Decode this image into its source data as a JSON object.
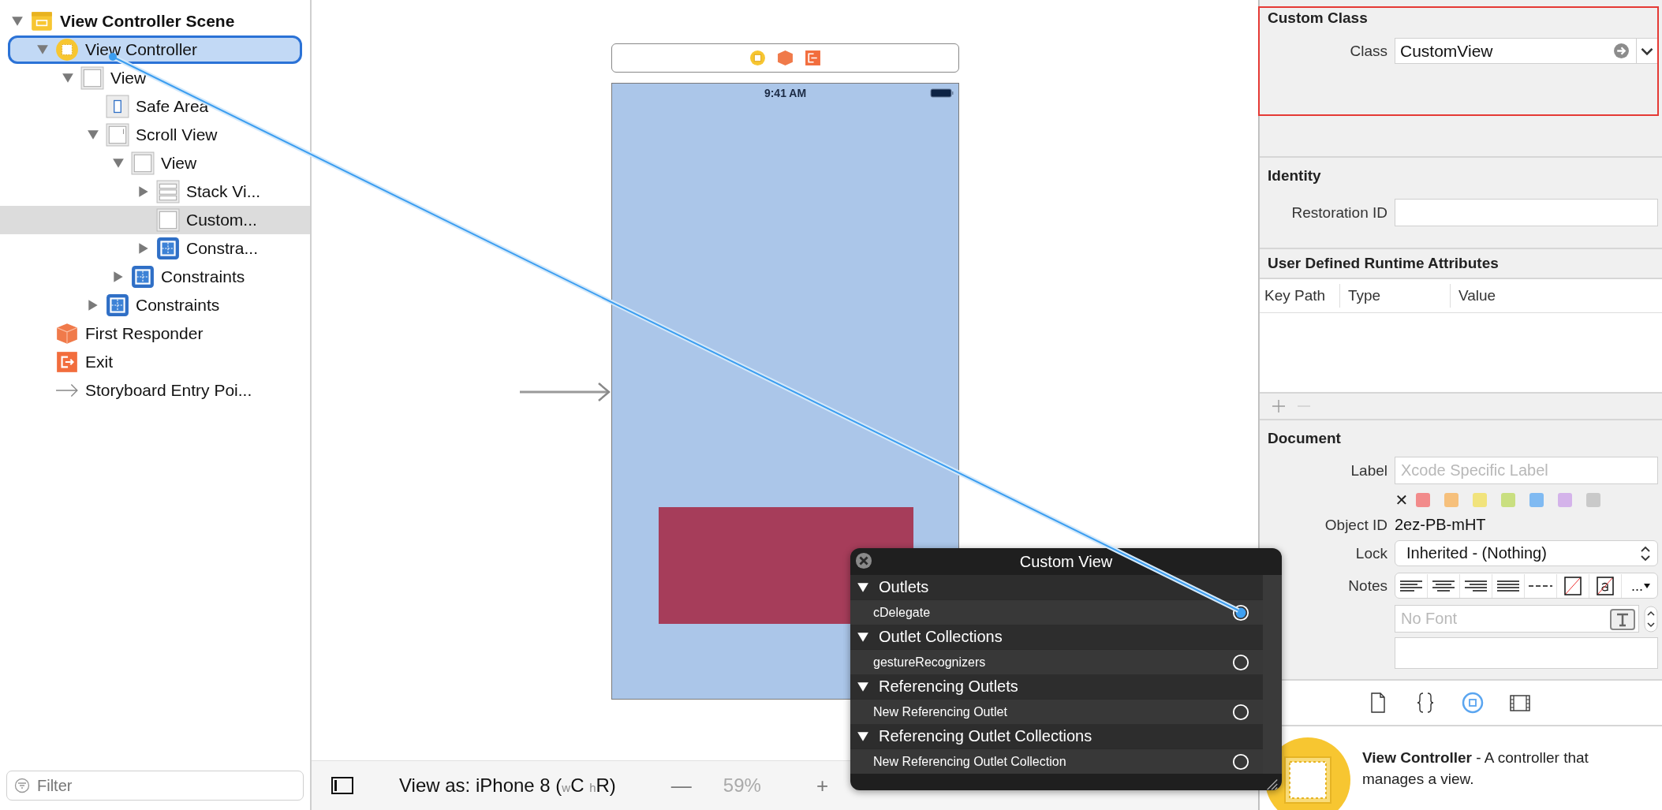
{
  "tree": {
    "items": [
      {
        "label": "View Controller Scene",
        "kind": "scene",
        "expanded": true,
        "selected": false,
        "drop_target": false,
        "children": [
          {
            "label": "View Controller",
            "kind": "controller",
            "expanded": true,
            "selected": false,
            "drop_target": true,
            "children": [
              {
                "label": "View",
                "kind": "view",
                "expanded": true,
                "selected": false,
                "drop_target": false,
                "children": [
                  {
                    "label": "Safe Area",
                    "kind": "safe-area",
                    "selected": false,
                    "drop_target": false
                  },
                  {
                    "label": "Scroll View",
                    "kind": "scroll-view",
                    "expanded": true,
                    "selected": false,
                    "drop_target": false,
                    "children": [
                      {
                        "label": "View",
                        "kind": "view",
                        "expanded": true,
                        "selected": false,
                        "drop_target": false,
                        "children": [
                          {
                            "label": "Stack Vi...",
                            "kind": "stack-view",
                            "expanded": false,
                            "selected": false,
                            "drop_target": false
                          },
                          {
                            "label": "Custom...",
                            "kind": "view",
                            "selected": true,
                            "drop_target": false
                          },
                          {
                            "label": "Constra...",
                            "kind": "constraints",
                            "expanded": false,
                            "selected": false,
                            "drop_target": false
                          }
                        ]
                      },
                      {
                        "label": "Constraints",
                        "kind": "constraints",
                        "expanded": false,
                        "selected": false,
                        "drop_target": false
                      }
                    ]
                  },
                  {
                    "label": "Constraints",
                    "kind": "constraints",
                    "expanded": false,
                    "selected": false,
                    "drop_target": false
                  }
                ]
              }
            ]
          },
          {
            "label": "First Responder",
            "kind": "responder",
            "selected": false,
            "drop_target": false
          },
          {
            "label": "Exit",
            "kind": "exit",
            "selected": false,
            "drop_target": false
          },
          {
            "label": "Storyboard Entry Poi...",
            "kind": "entry",
            "selected": false,
            "drop_target": false
          }
        ]
      }
    ]
  },
  "filter": {
    "placeholder": "Filter"
  },
  "canvas": {
    "status_time": "9:41 AM",
    "view_as": "View as: iPhone 8 ($_{w}$C $_{h}$R)",
    "zoom_out": "—",
    "zoom": "59%",
    "zoom_in": "+"
  },
  "connections_popup": {
    "title": "Custom View",
    "sections": [
      {
        "title": "Outlets",
        "expanded": true,
        "rows": [
          {
            "name": "cDelegate",
            "connected": true
          }
        ]
      },
      {
        "title": "Outlet Collections",
        "expanded": true,
        "rows": [
          {
            "name": "gestureRecognizers",
            "connected": false
          }
        ]
      },
      {
        "title": "Referencing Outlets",
        "expanded": true,
        "rows": [
          {
            "name": "New Referencing Outlet",
            "connected": false
          }
        ]
      },
      {
        "title": "Referencing Outlet Collections",
        "expanded": true,
        "rows": [
          {
            "name": "New Referencing Outlet Collection",
            "connected": false
          }
        ]
      }
    ]
  },
  "inspector": {
    "custom_class": {
      "title": "Custom Class",
      "class_label": "Class",
      "class_value": "CustomView"
    },
    "identity": {
      "title": "Identity",
      "restoration_label": "Restoration ID"
    },
    "runtime_attributes": {
      "title": "User Defined Runtime Attributes",
      "columns": [
        "Key Path",
        "Type",
        "Value"
      ]
    },
    "document": {
      "title": "Document",
      "label_label": "Label",
      "label_placeholder": "Xcode Specific Label",
      "clear_mark": "✕",
      "swatches": [
        {
          "color": "#f28b8b"
        },
        {
          "color": "#f6c07c"
        },
        {
          "color": "#f1e37c"
        },
        {
          "color": "#c9df80"
        },
        {
          "color": "#80baf2"
        },
        {
          "color": "#d4b3ea"
        },
        {
          "color": "#c9c9c9"
        }
      ],
      "object_id_label": "Object ID",
      "object_id": "2ez-PB-mHT",
      "lock_label": "Lock",
      "lock_value": "Inherited - (Nothing)",
      "notes_label": "Notes",
      "notes_tools": [
        {
          "kind": "left"
        },
        {
          "kind": "center"
        },
        {
          "kind": "right"
        },
        {
          "kind": "justify"
        },
        {
          "kind": "dashes"
        },
        {
          "kind": "no-color"
        },
        {
          "kind": "text-color"
        },
        {
          "kind": "more",
          "label": "..."
        }
      ],
      "font_placeholder": "No Font"
    },
    "tabs": [
      {
        "kind": "file",
        "selected": false
      },
      {
        "kind": "braces",
        "selected": false
      },
      {
        "kind": "identity",
        "selected": true
      },
      {
        "kind": "library",
        "selected": false
      }
    ],
    "library_item": {
      "description": "**View Controller** - A controller that manages a view."
    }
  }
}
